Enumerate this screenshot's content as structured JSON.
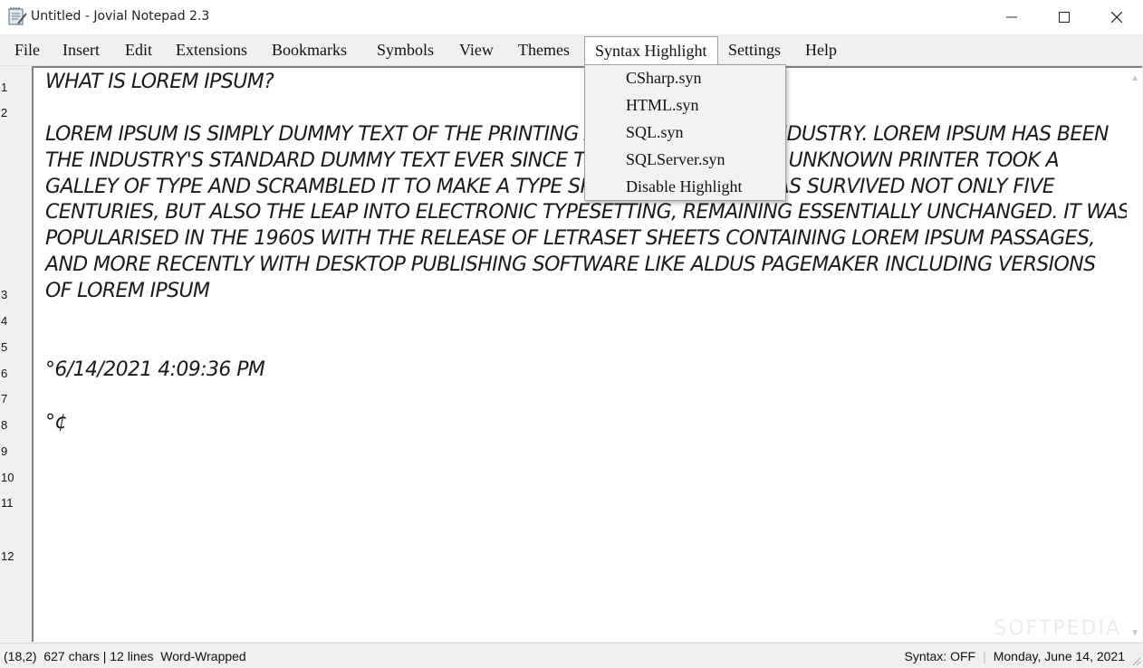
{
  "window": {
    "title": "Untitled - Jovial Notepad 2.3",
    "controls": {
      "minimize": "minimize",
      "maximize": "maximize",
      "close": "close"
    }
  },
  "menubar": {
    "items": [
      {
        "label": "File"
      },
      {
        "label": "Insert"
      },
      {
        "label": "Edit"
      },
      {
        "label": "Extensions"
      },
      {
        "label": "Bookmarks"
      },
      {
        "label": "Symbols"
      },
      {
        "label": "View"
      },
      {
        "label": "Themes"
      },
      {
        "label": "Syntax Highlight",
        "active": true
      },
      {
        "label": "Settings"
      },
      {
        "label": "Help"
      }
    ]
  },
  "syntax_menu": {
    "items": [
      {
        "label": "CSharp.syn"
      },
      {
        "label": "HTML.syn"
      },
      {
        "label": "SQL.syn"
      },
      {
        "label": "SQLServer.syn"
      },
      {
        "label": "Disable Highlight"
      }
    ]
  },
  "gutter": {
    "numbers": [
      "1",
      "2",
      "3",
      "4",
      "5",
      "6",
      "7",
      "8",
      "9",
      "10",
      "11",
      "12"
    ]
  },
  "editor": {
    "lines": [
      "WHAT IS LOREM IPSUM?",
      "",
      "LOREM IPSUM IS SIMPLY DUMMY TEXT OF THE PRINTING AND TYPESETTING INDUSTRY. LOREM IPSUM HAS BEEN",
      "THE INDUSTRY'S STANDARD DUMMY TEXT EVER SINCE THE 1500S, WHEN AN UNKNOWN PRINTER TOOK A",
      "GALLEY OF TYPE AND SCRAMBLED IT TO MAKE A TYPE SPECIMEN BOOK. IT HAS SURVIVED NOT ONLY FIVE",
      "CENTURIES, BUT ALSO THE LEAP INTO ELECTRONIC TYPESETTING, REMAINING ESSENTIALLY UNCHANGED. IT WAS",
      "POPULARISED IN THE 1960S WITH THE RELEASE OF LETRASET SHEETS CONTAINING LOREM IPSUM PASSAGES,",
      "AND MORE RECENTLY WITH DESKTOP PUBLISHING SOFTWARE LIKE ALDUS PAGEMAKER INCLUDING VERSIONS",
      "OF LOREM IPSUM",
      "",
      "",
      "°6/14/2021 4:09:36 PM",
      "",
      "°¢"
    ]
  },
  "statusbar": {
    "position": "(18,2)",
    "chars": "627 chars | 12 lines",
    "wrap": "Word-Wrapped",
    "syntax": "Syntax: OFF",
    "date": "Monday, June 14, 2021"
  },
  "watermark": "SOFTPEDIA",
  "colors": {
    "background": "#f0f0f0",
    "editor": "#ffffff",
    "menu_active_border": "#a0a0a0"
  }
}
